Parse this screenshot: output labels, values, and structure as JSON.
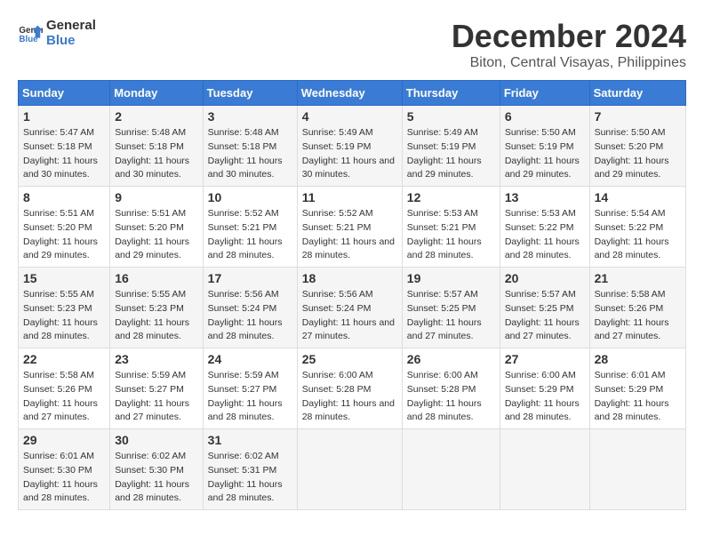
{
  "logo": {
    "text_general": "General",
    "text_blue": "Blue"
  },
  "title": "December 2024",
  "location": "Biton, Central Visayas, Philippines",
  "weekdays": [
    "Sunday",
    "Monday",
    "Tuesday",
    "Wednesday",
    "Thursday",
    "Friday",
    "Saturday"
  ],
  "weeks": [
    [
      {
        "day": "1",
        "sunrise": "5:47 AM",
        "sunset": "5:18 PM",
        "daylight": "11 hours and 30 minutes."
      },
      {
        "day": "2",
        "sunrise": "5:48 AM",
        "sunset": "5:18 PM",
        "daylight": "11 hours and 30 minutes."
      },
      {
        "day": "3",
        "sunrise": "5:48 AM",
        "sunset": "5:18 PM",
        "daylight": "11 hours and 30 minutes."
      },
      {
        "day": "4",
        "sunrise": "5:49 AM",
        "sunset": "5:19 PM",
        "daylight": "11 hours and 30 minutes."
      },
      {
        "day": "5",
        "sunrise": "5:49 AM",
        "sunset": "5:19 PM",
        "daylight": "11 hours and 29 minutes."
      },
      {
        "day": "6",
        "sunrise": "5:50 AM",
        "sunset": "5:19 PM",
        "daylight": "11 hours and 29 minutes."
      },
      {
        "day": "7",
        "sunrise": "5:50 AM",
        "sunset": "5:20 PM",
        "daylight": "11 hours and 29 minutes."
      }
    ],
    [
      {
        "day": "8",
        "sunrise": "5:51 AM",
        "sunset": "5:20 PM",
        "daylight": "11 hours and 29 minutes."
      },
      {
        "day": "9",
        "sunrise": "5:51 AM",
        "sunset": "5:20 PM",
        "daylight": "11 hours and 29 minutes."
      },
      {
        "day": "10",
        "sunrise": "5:52 AM",
        "sunset": "5:21 PM",
        "daylight": "11 hours and 28 minutes."
      },
      {
        "day": "11",
        "sunrise": "5:52 AM",
        "sunset": "5:21 PM",
        "daylight": "11 hours and 28 minutes."
      },
      {
        "day": "12",
        "sunrise": "5:53 AM",
        "sunset": "5:21 PM",
        "daylight": "11 hours and 28 minutes."
      },
      {
        "day": "13",
        "sunrise": "5:53 AM",
        "sunset": "5:22 PM",
        "daylight": "11 hours and 28 minutes."
      },
      {
        "day": "14",
        "sunrise": "5:54 AM",
        "sunset": "5:22 PM",
        "daylight": "11 hours and 28 minutes."
      }
    ],
    [
      {
        "day": "15",
        "sunrise": "5:55 AM",
        "sunset": "5:23 PM",
        "daylight": "11 hours and 28 minutes."
      },
      {
        "day": "16",
        "sunrise": "5:55 AM",
        "sunset": "5:23 PM",
        "daylight": "11 hours and 28 minutes."
      },
      {
        "day": "17",
        "sunrise": "5:56 AM",
        "sunset": "5:24 PM",
        "daylight": "11 hours and 28 minutes."
      },
      {
        "day": "18",
        "sunrise": "5:56 AM",
        "sunset": "5:24 PM",
        "daylight": "11 hours and 27 minutes."
      },
      {
        "day": "19",
        "sunrise": "5:57 AM",
        "sunset": "5:25 PM",
        "daylight": "11 hours and 27 minutes."
      },
      {
        "day": "20",
        "sunrise": "5:57 AM",
        "sunset": "5:25 PM",
        "daylight": "11 hours and 27 minutes."
      },
      {
        "day": "21",
        "sunrise": "5:58 AM",
        "sunset": "5:26 PM",
        "daylight": "11 hours and 27 minutes."
      }
    ],
    [
      {
        "day": "22",
        "sunrise": "5:58 AM",
        "sunset": "5:26 PM",
        "daylight": "11 hours and 27 minutes."
      },
      {
        "day": "23",
        "sunrise": "5:59 AM",
        "sunset": "5:27 PM",
        "daylight": "11 hours and 27 minutes."
      },
      {
        "day": "24",
        "sunrise": "5:59 AM",
        "sunset": "5:27 PM",
        "daylight": "11 hours and 28 minutes."
      },
      {
        "day": "25",
        "sunrise": "6:00 AM",
        "sunset": "5:28 PM",
        "daylight": "11 hours and 28 minutes."
      },
      {
        "day": "26",
        "sunrise": "6:00 AM",
        "sunset": "5:28 PM",
        "daylight": "11 hours and 28 minutes."
      },
      {
        "day": "27",
        "sunrise": "6:00 AM",
        "sunset": "5:29 PM",
        "daylight": "11 hours and 28 minutes."
      },
      {
        "day": "28",
        "sunrise": "6:01 AM",
        "sunset": "5:29 PM",
        "daylight": "11 hours and 28 minutes."
      }
    ],
    [
      {
        "day": "29",
        "sunrise": "6:01 AM",
        "sunset": "5:30 PM",
        "daylight": "11 hours and 28 minutes."
      },
      {
        "day": "30",
        "sunrise": "6:02 AM",
        "sunset": "5:30 PM",
        "daylight": "11 hours and 28 minutes."
      },
      {
        "day": "31",
        "sunrise": "6:02 AM",
        "sunset": "5:31 PM",
        "daylight": "11 hours and 28 minutes."
      },
      null,
      null,
      null,
      null
    ]
  ]
}
